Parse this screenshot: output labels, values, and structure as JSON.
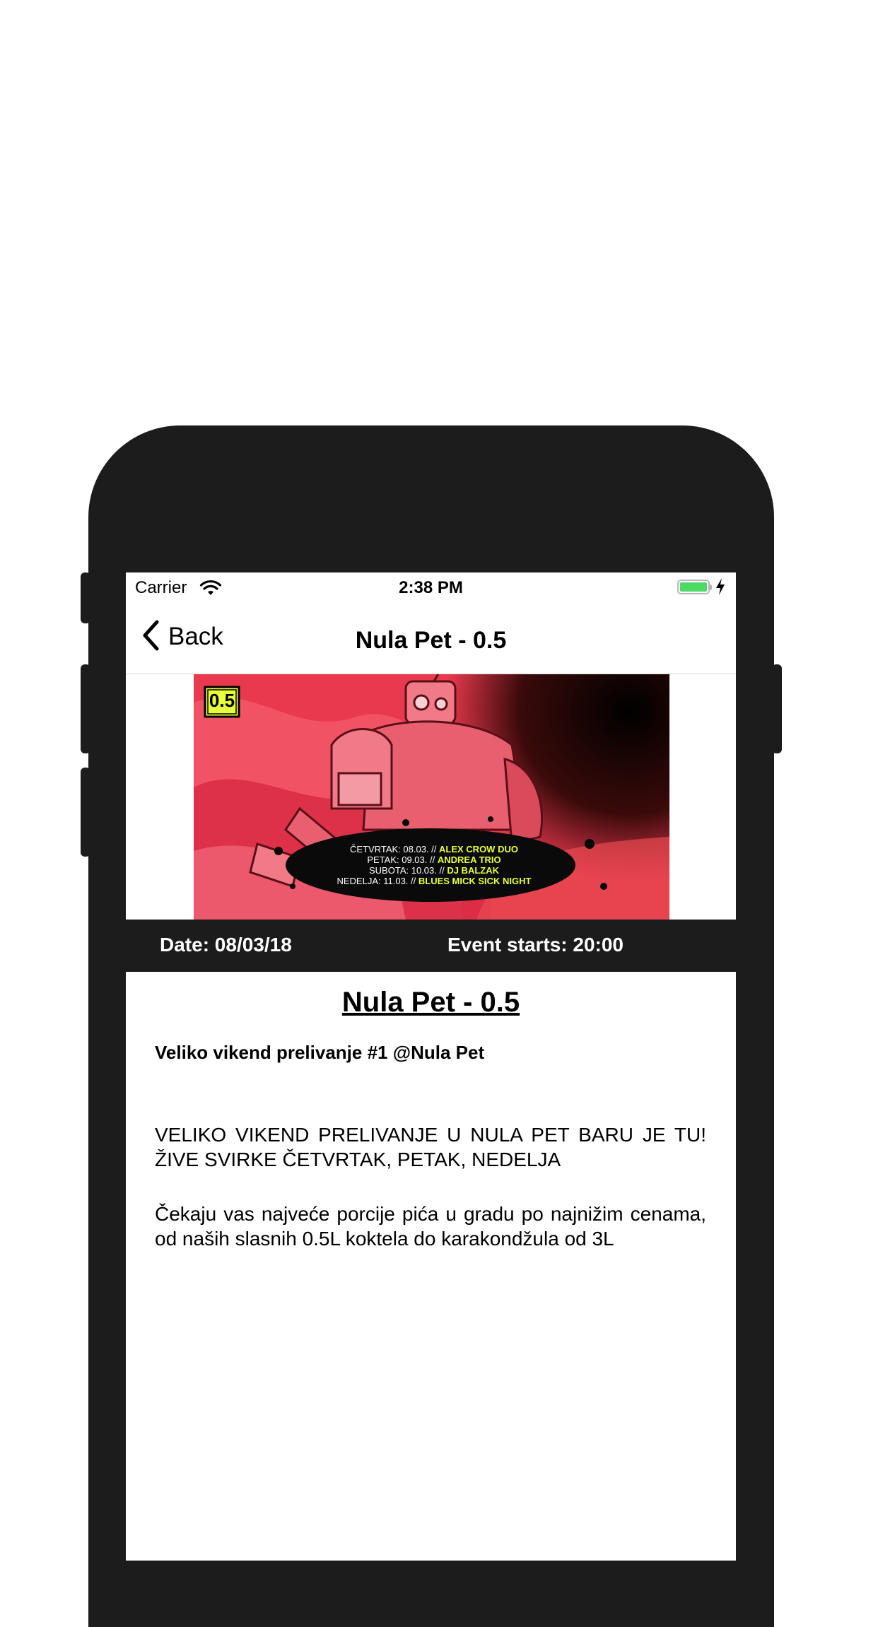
{
  "status_bar": {
    "carrier": "Carrier",
    "time": "2:38 PM",
    "battery_color": "#4cd964"
  },
  "nav": {
    "back_label": "Back",
    "title": "Nula Pet - 0.5"
  },
  "poster": {
    "badge": "0.5",
    "lineup": [
      {
        "day": "ČETVRTAK: 08.03. //",
        "act": "ALEX CROW DUO"
      },
      {
        "day": "PETAK: 09.03. //",
        "act": "ANDREA TRIO"
      },
      {
        "day": "SUBOTA: 10.03. //",
        "act": "DJ BALZAK"
      },
      {
        "day": "NEDELJA: 11.03. //",
        "act": "BLUES MICK SICK NIGHT"
      }
    ],
    "accent": "#e8ff3a",
    "base_color": "#e8394e"
  },
  "info": {
    "date": "Date: 08/03/18",
    "starts": "Event starts: 20:00"
  },
  "content": {
    "title": "Nula Pet - 0.5",
    "subtitle": "Veliko vikend prelivanje #1 @Nula Pet",
    "paragraph1_line1": "VELIKO VIKEND PRELIVANJE U NULA PET BARU JE TU!",
    "paragraph1_line2": "ŽIVE SVIRKE ČETVRTAK, PETAK, NEDELJA",
    "paragraph2": "Čekaju vas najveće porcije pića u gradu po najnižim cenama, od naših slasnih 0.5L koktela do karakondžula od 3L"
  },
  "colors": {
    "frame": "#1c1c1c",
    "infobar_bg": "#1c1c1c",
    "text": "#000000"
  }
}
